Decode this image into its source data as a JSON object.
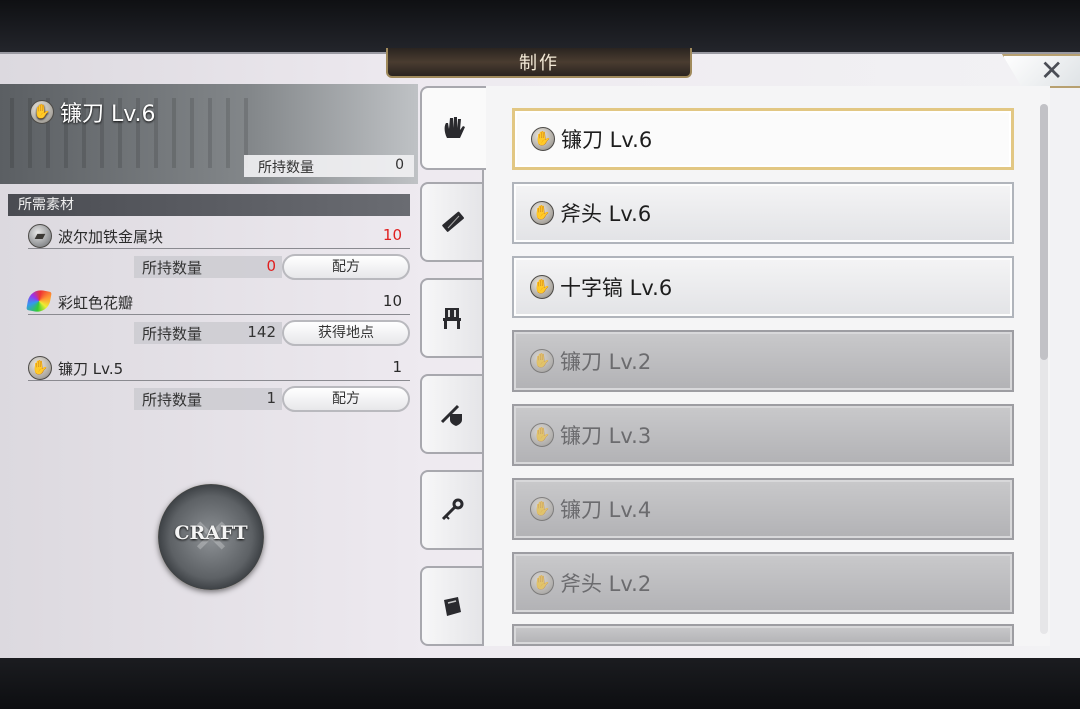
{
  "window": {
    "title": "制作",
    "close_symbol": "✕"
  },
  "item": {
    "name": "镰刀 Lv.6",
    "owned_label": "所持数量",
    "owned_value": "0"
  },
  "materials_section": {
    "title": "所需素材"
  },
  "materials": [
    {
      "name": "波尔加铁金属块",
      "required": "10",
      "required_insufficient": true,
      "owned_label": "所持数量",
      "owned": "0",
      "owned_insufficient": true,
      "button": "配方",
      "icon": "metal-block-icon"
    },
    {
      "name": "彩虹色花瓣",
      "required": "10",
      "required_insufficient": false,
      "owned_label": "所持数量",
      "owned": "142",
      "owned_insufficient": false,
      "button": "获得地点",
      "icon": "rainbow-petal-icon"
    },
    {
      "name": "镰刀 Lv.5",
      "required": "1",
      "required_insufficient": false,
      "owned_label": "所持数量",
      "owned": "1",
      "owned_insufficient": false,
      "button": "配方",
      "icon": "glove-icon"
    }
  ],
  "craft_button": {
    "label": "CRAFT"
  },
  "tabs": [
    {
      "icon": "glove-icon",
      "active": true
    },
    {
      "icon": "material-bar-icon",
      "active": false
    },
    {
      "icon": "chair-icon",
      "active": false
    },
    {
      "icon": "shield-sword-icon",
      "active": false
    },
    {
      "icon": "key-icon",
      "active": false
    },
    {
      "icon": "scroll-icon",
      "active": false
    }
  ],
  "recipes": [
    {
      "label": "镰刀 Lv.6",
      "state": "selected"
    },
    {
      "label": "斧头 Lv.6",
      "state": "available"
    },
    {
      "label": "十字镐 Lv.6",
      "state": "available"
    },
    {
      "label": "镰刀 Lv.2",
      "state": "locked"
    },
    {
      "label": "镰刀 Lv.3",
      "state": "locked"
    },
    {
      "label": "镰刀 Lv.4",
      "state": "locked"
    },
    {
      "label": "斧头 Lv.2",
      "state": "locked"
    }
  ],
  "colors": {
    "insufficient": "#e02020",
    "selected_border": "#e2c783",
    "title_bar": "#3a302a"
  }
}
